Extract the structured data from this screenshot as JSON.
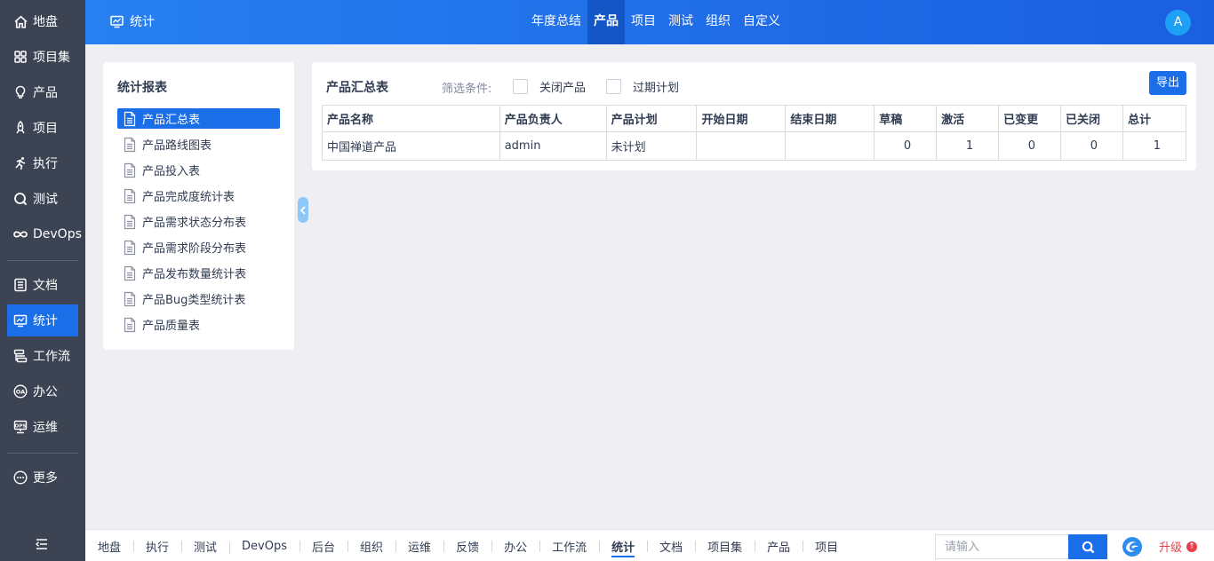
{
  "sidebar": {
    "items": [
      {
        "label": "地盘",
        "icon": "home-icon"
      },
      {
        "label": "项目集",
        "icon": "grid-icon"
      },
      {
        "label": "产品",
        "icon": "bulb-icon"
      },
      {
        "label": "项目",
        "icon": "rocket-icon"
      },
      {
        "label": "执行",
        "icon": "run-icon"
      },
      {
        "label": "测试",
        "icon": "magnifier-icon"
      },
      {
        "label": "DevOps",
        "icon": "infinity-icon"
      },
      {
        "label": "文档",
        "icon": "doc-list-icon"
      },
      {
        "label": "统计",
        "icon": "monitor-chart-icon"
      },
      {
        "label": "工作流",
        "icon": "workflow-icon"
      },
      {
        "label": "办公",
        "icon": "oa-icon"
      },
      {
        "label": "运维",
        "icon": "ops-icon"
      },
      {
        "label": "更多",
        "icon": "more-icon"
      }
    ]
  },
  "header": {
    "title": "统计",
    "tabs": [
      "年度总结",
      "产品",
      "项目",
      "测试",
      "组织",
      "自定义"
    ],
    "active_tab": "产品",
    "avatar": "A"
  },
  "reports": {
    "title": "统计报表",
    "items": [
      "产品汇总表",
      "产品路线图表",
      "产品投入表",
      "产品完成度统计表",
      "产品需求状态分布表",
      "产品需求阶段分布表",
      "产品发布数量统计表",
      "产品Bug类型统计表",
      "产品质量表"
    ],
    "active": "产品汇总表"
  },
  "main": {
    "title": "产品汇总表",
    "filter_label": "筛选条件:",
    "filters": [
      "关闭产品",
      "过期计划"
    ],
    "export_label": "导出",
    "columns": [
      "产品名称",
      "产品负责人",
      "产品计划",
      "开始日期",
      "结束日期",
      "草稿",
      "激活",
      "已变更",
      "已关闭",
      "总计"
    ],
    "rows": [
      [
        "中国禅道产品",
        "admin",
        "未计划",
        "",
        "",
        "0",
        "1",
        "0",
        "0",
        "1"
      ]
    ]
  },
  "footer": {
    "items": [
      "地盘",
      "执行",
      "测试",
      "DevOps",
      "后台",
      "组织",
      "运维",
      "反馈",
      "办公",
      "工作流",
      "统计",
      "文档",
      "项目集",
      "产品",
      "项目"
    ],
    "active": "统计",
    "search_placeholder": "请输入",
    "upgrade_label": "升级",
    "upgrade_badge": "↑"
  },
  "colors": {
    "accent": "#1a6fe8",
    "sidebar_bg": "#3c4353",
    "upgrade": "#e8404c"
  }
}
